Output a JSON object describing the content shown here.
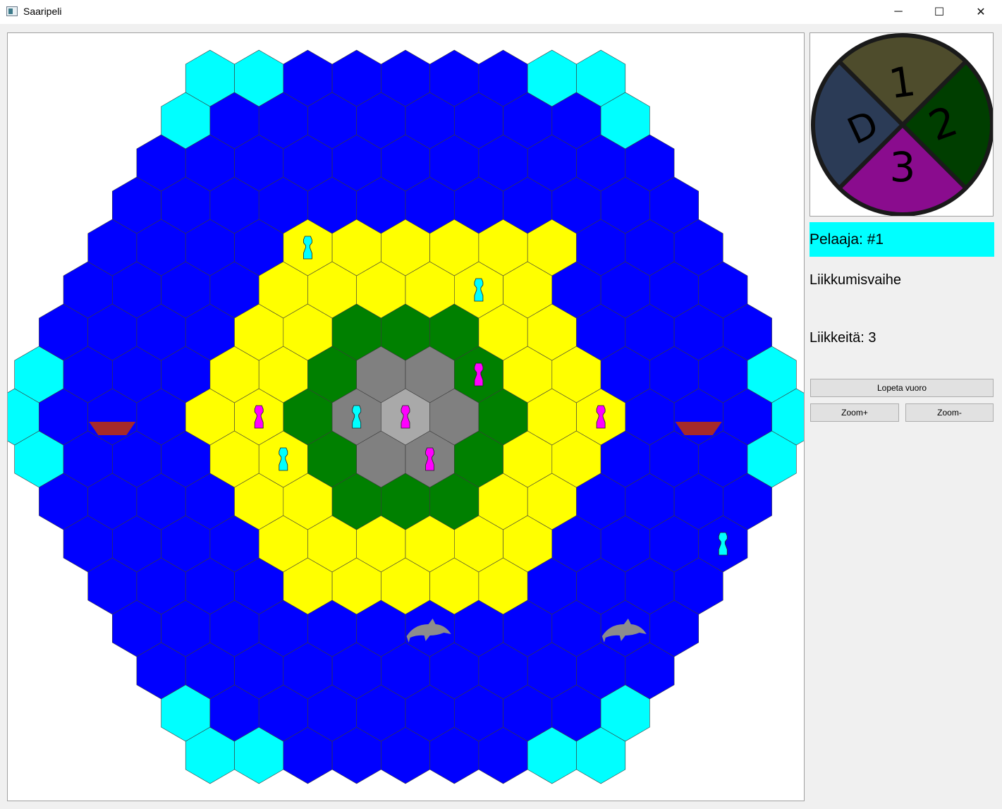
{
  "window": {
    "title": "Saaripeli",
    "minimize_glyph": "─",
    "maximize_glyph": "☐",
    "close_glyph": "✕"
  },
  "side_panel": {
    "player_label": "Pelaaja: #1",
    "player_color": "#00ffff",
    "phase_label": "Liikkumisvaihe",
    "moves_label": "Liikkeitä: 3",
    "end_turn_button": "Lopeta vuoro",
    "zoom_in_button": "Zoom+",
    "zoom_out_button": "Zoom-"
  },
  "wheel": {
    "segments": [
      {
        "label": "1",
        "color": "#4e4c2c"
      },
      {
        "label": "2",
        "color": "#003e00"
      },
      {
        "label": "3",
        "color": "#8a0c8e"
      },
      {
        "label": "D",
        "color": "#2b3b56"
      }
    ]
  },
  "board": {
    "tile_colors": {
      "deep": "#0000ff",
      "coral": "#00ffff",
      "beach": "#ffff00",
      "forest": "#008000",
      "mountain": "#808080",
      "peak": "#a9a9a9"
    },
    "icons": [
      "pawn-icon",
      "boat-icon",
      "dolphin-icon"
    ],
    "pawn_colors": {
      "player1": "#00ffff",
      "player2": "#ff00ff"
    },
    "boat_color": "#a52a2a",
    "dolphin_color": "#8c8c8c",
    "map_radius": 8,
    "coral_cells": [
      [
        -8,
        0
      ],
      [
        -8,
        1
      ],
      [
        -7,
        -1
      ],
      [
        -1,
        -7
      ],
      [
        0,
        -8
      ],
      [
        1,
        -8
      ],
      [
        8,
        0
      ],
      [
        8,
        -1
      ],
      [
        7,
        1
      ],
      [
        1,
        7
      ],
      [
        0,
        8
      ],
      [
        -1,
        8
      ],
      [
        8,
        -8
      ],
      [
        7,
        -8
      ],
      [
        8,
        -7
      ],
      [
        -8,
        8
      ],
      [
        -7,
        8
      ],
      [
        -8,
        7
      ]
    ],
    "peak_cells": [
      [
        0,
        0
      ]
    ],
    "mountain_cells": [
      [
        1,
        -1
      ],
      [
        1,
        0
      ],
      [
        0,
        1
      ],
      [
        -1,
        1
      ],
      [
        -1,
        0
      ],
      [
        0,
        -1
      ]
    ],
    "forest_cells": [
      [
        2,
        0
      ],
      [
        2,
        -1
      ],
      [
        2,
        -2
      ],
      [
        1,
        -2
      ],
      [
        0,
        -2
      ],
      [
        -1,
        -1
      ],
      [
        -2,
        0
      ],
      [
        -2,
        1
      ],
      [
        -2,
        2
      ],
      [
        -1,
        2
      ],
      [
        0,
        2
      ],
      [
        1,
        1
      ]
    ],
    "beach_cells": [
      [
        -4,
        0
      ],
      [
        -4,
        1
      ],
      [
        -4,
        2
      ],
      [
        -4,
        3
      ],
      [
        -4,
        4
      ],
      [
        -3,
        -1
      ],
      [
        -3,
        4
      ],
      [
        -2,
        -2
      ],
      [
        -2,
        4
      ],
      [
        -1,
        -3
      ],
      [
        -1,
        4
      ],
      [
        0,
        -4
      ],
      [
        0,
        -3
      ],
      [
        0,
        3
      ],
      [
        0,
        4
      ],
      [
        1,
        -4
      ],
      [
        1,
        -3
      ],
      [
        1,
        2
      ],
      [
        1,
        3
      ],
      [
        2,
        -4
      ],
      [
        2,
        -3
      ],
      [
        2,
        1
      ],
      [
        2,
        2
      ],
      [
        3,
        -4
      ],
      [
        3,
        -3
      ],
      [
        3,
        -2
      ],
      [
        3,
        -1
      ],
      [
        3,
        0
      ],
      [
        3,
        1
      ],
      [
        4,
        -4
      ],
      [
        4,
        -3
      ],
      [
        4,
        -2
      ],
      [
        4,
        -1
      ],
      [
        4,
        0
      ],
      [
        -3,
        0
      ],
      [
        -3,
        1
      ],
      [
        -3,
        2
      ],
      [
        -3,
        3
      ],
      [
        -2,
        3
      ],
      [
        -1,
        3
      ],
      [
        -2,
        -1
      ],
      [
        -1,
        -2
      ],
      [
        5,
        -4
      ]
    ],
    "pawns": [
      {
        "q": 0,
        "r": -4,
        "owner": "player1"
      },
      {
        "q": 3,
        "r": -3,
        "owner": "player1"
      },
      {
        "q": -3,
        "r": 1,
        "owner": "player1"
      },
      {
        "q": -1,
        "r": 0,
        "owner": "player1"
      },
      {
        "q": 5,
        "r": 3,
        "owner": "player1"
      },
      {
        "q": 0,
        "r": 0,
        "owner": "player2"
      },
      {
        "q": 2,
        "r": -1,
        "owner": "player2"
      },
      {
        "q": -3,
        "r": 0,
        "owner": "player2"
      },
      {
        "q": 0,
        "r": 1,
        "owner": "player2"
      },
      {
        "q": 4,
        "r": 0,
        "owner": "player2"
      }
    ],
    "boats": [
      {
        "q": -6,
        "r": 0
      },
      {
        "q": 6,
        "r": 0
      }
    ],
    "dolphins": [
      {
        "q": -2,
        "r": 5
      },
      {
        "q": 2,
        "r": 5
      }
    ]
  }
}
